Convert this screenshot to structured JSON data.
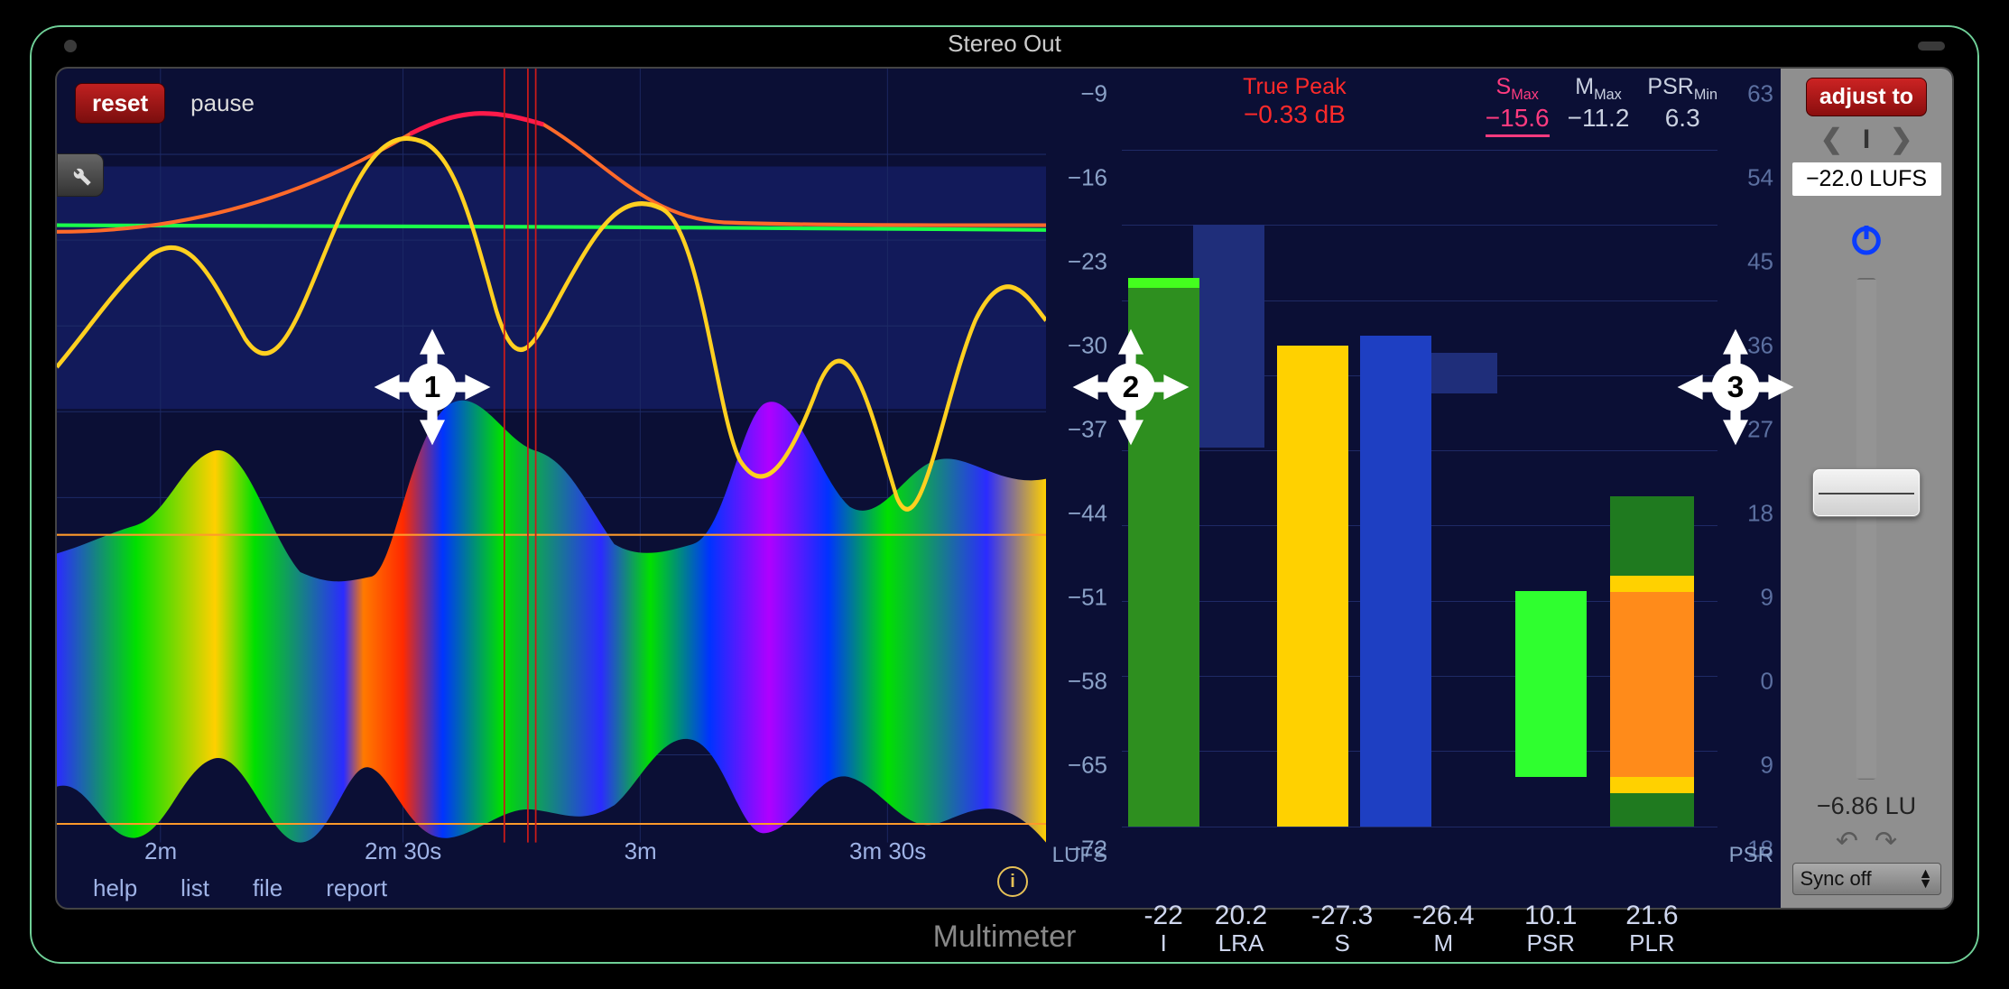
{
  "window": {
    "title": "Stereo Out"
  },
  "footer": {
    "title": "Multimeter"
  },
  "graph": {
    "reset_label": "reset",
    "pause_label": "pause",
    "time_ticks": [
      {
        "label": "2m",
        "x_pct": 10.5
      },
      {
        "label": "2m 30s",
        "x_pct": 35
      },
      {
        "label": "3m",
        "x_pct": 59
      },
      {
        "label": "3m 30s",
        "x_pct": 84
      }
    ],
    "links": {
      "help": "help",
      "list": "list",
      "file": "file",
      "report": "report"
    },
    "info_label": "i"
  },
  "lufs_scale": {
    "ticks": [
      "−9",
      "−16",
      "−23",
      "−30",
      "−37",
      "−44",
      "−51",
      "−58",
      "−65",
      "−72"
    ],
    "unit": "LUFS"
  },
  "readout": {
    "true_peak": {
      "label": "True Peak",
      "value": "−0.33 dB"
    },
    "s_max": {
      "label_prefix": "S",
      "label_sub": "Max",
      "value": "−15.6"
    },
    "m_max": {
      "label_prefix": "M",
      "label_sub": "Max",
      "value": "−11.2"
    },
    "psr_min": {
      "label_prefix": "PSR",
      "label_sub": "Min",
      "value": "6.3"
    }
  },
  "chart_data": {
    "type": "bar",
    "lufs_range": [
      -72,
      -9
    ],
    "psr_range": [
      63,
      -18
    ],
    "bars": [
      {
        "name": "I",
        "value": -22.0,
        "top_lufs": -22.0,
        "ghost_top_lufs": -16,
        "ghost_bot_lufs": -37,
        "color": "#2e8f1f",
        "cap": "#44ff1e"
      },
      {
        "name": "LRA",
        "value": 20.2,
        "top_lufs": -16,
        "bot_lufs": -36,
        "color": "#1f2e7a",
        "ghost": true
      },
      {
        "name": "S",
        "value": -27.3,
        "top_lufs": -27.3,
        "color": "#ffd100"
      },
      {
        "name": "M",
        "value": -26.4,
        "top_lufs": -26.4,
        "ghost_top_lufs": -28,
        "ghost_bot_lufs": -32,
        "color": "#1e3fc2"
      },
      {
        "name": "PSR",
        "value": 10.1,
        "psr_top": 10.1,
        "psr_bot": -12,
        "color": "#2fff2f"
      },
      {
        "name": "PLR",
        "value": 21.6,
        "psr_segments": [
          {
            "from": 21.6,
            "to": 12,
            "color": "#1f7a1f"
          },
          {
            "from": 12,
            "to": 10,
            "color": "#ffd100"
          },
          {
            "from": 10,
            "to": -12,
            "color": "#ff8b1a"
          },
          {
            "from": -12,
            "to": -14,
            "color": "#ffd100"
          },
          {
            "from": -14,
            "to": -18,
            "color": "#1f7a1f"
          }
        ]
      }
    ]
  },
  "psr_scale": {
    "ticks": [
      "63",
      "54",
      "45",
      "36",
      "27",
      "18",
      "9",
      "0",
      "9",
      "18"
    ],
    "unit": "PSR"
  },
  "adjust": {
    "button": "adjust to",
    "preset_index": "I",
    "target": "−22.0 LUFS",
    "lu_readout": "−6.86 LU",
    "sync_label": "Sync off"
  },
  "markers": {
    "1": "1",
    "2": "2",
    "3": "3"
  }
}
